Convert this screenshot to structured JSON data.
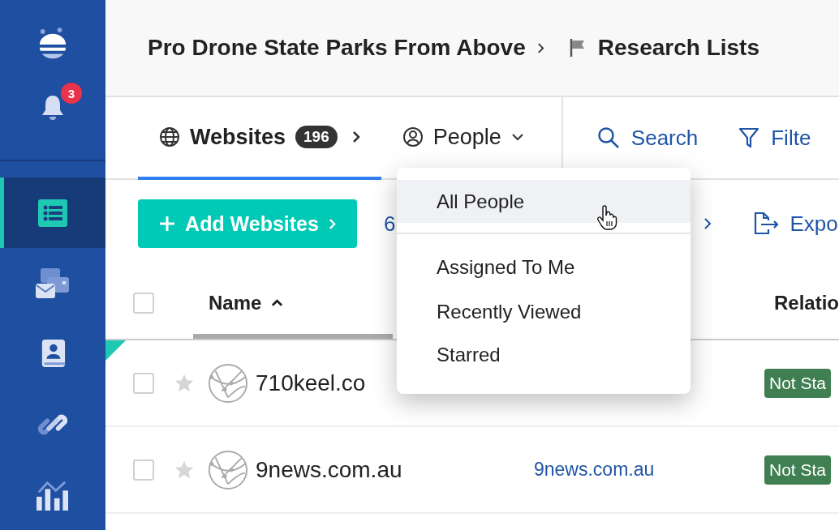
{
  "sidebar": {
    "notification_count": "3",
    "items": [
      {
        "kind": "lists",
        "selected": true
      },
      {
        "kind": "messages",
        "selected": false
      },
      {
        "kind": "contacts",
        "selected": false
      },
      {
        "kind": "links",
        "selected": false
      },
      {
        "kind": "reports",
        "selected": false
      }
    ]
  },
  "header": {
    "project": "Pro Drone State Parks From Above",
    "section": "Research Lists"
  },
  "tabs": [
    {
      "label": "Websites",
      "count": "196",
      "kind": "count",
      "selected": true
    },
    {
      "label": "People",
      "kind": "menu",
      "selected": false
    }
  ],
  "actions": [
    {
      "label": "Search",
      "kind": "search"
    },
    {
      "label": "Filte",
      "kind": "filter"
    }
  ],
  "toolbar": {
    "add_button": "Add Websites",
    "count_text": "6",
    "export": "Expo"
  },
  "dropdown": {
    "items": [
      {
        "label": "All People",
        "selected": true
      },
      {
        "label": "Assigned To Me",
        "selected": false
      },
      {
        "label": "Recently Viewed",
        "selected": false
      },
      {
        "label": "Starred",
        "selected": false
      }
    ]
  },
  "table": {
    "select_all_checked": false,
    "columns": [
      "Name",
      "Relatio"
    ],
    "rows": [
      {
        "name": "710keel.co",
        "status": "Not Sta",
        "checked": false,
        "starred": false,
        "new": true
      },
      {
        "name": "9news.com.au",
        "url": "9news.com.au",
        "status": "Not Sta",
        "checked": false,
        "starred": false,
        "new": false
      }
    ]
  }
}
